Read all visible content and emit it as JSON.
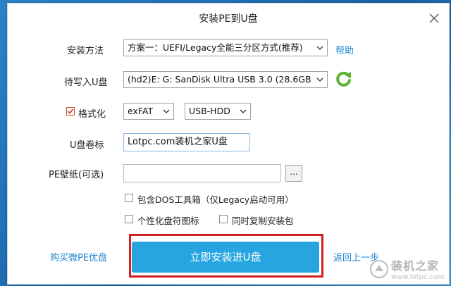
{
  "window": {
    "title": "安装PE到U盘"
  },
  "form": {
    "install_method_label": "安装方法",
    "install_method_value": "方案一：UEFI/Legacy全能三分区方式(推荐)",
    "help_label": "帮助",
    "target_usb_label": "待写入U盘",
    "target_usb_value": "(hd2)E: G: SanDisk Ultra USB 3.0 (28.6GB",
    "format_label": "格式化",
    "format_checked": true,
    "filesystem_value": "exFAT",
    "mode_value": "USB-HDD",
    "volume_label_label": "U盘卷标",
    "volume_label_value": "Lotpc.com装机之家U盘",
    "wallpaper_label": "PE壁纸(可选)",
    "wallpaper_value": "",
    "browse_label": "...",
    "include_dos_label": "包含DOS工具箱（仅Legacy启动可用）",
    "personalize_icon_label": "个性化盘符图标",
    "copy_installer_label": "同时复制安装包"
  },
  "footer": {
    "buy_link": "购买微PE优盘",
    "install_button": "立即安装进U盘",
    "back_link": "返回上一步"
  },
  "watermark": {
    "main": "装机之家",
    "sub": "www.lotpc.com"
  },
  "colors": {
    "accent": "#26a5e0",
    "link": "#1f86d6",
    "highlight": "#d21f1f",
    "refresh_icon": "#5db233"
  }
}
